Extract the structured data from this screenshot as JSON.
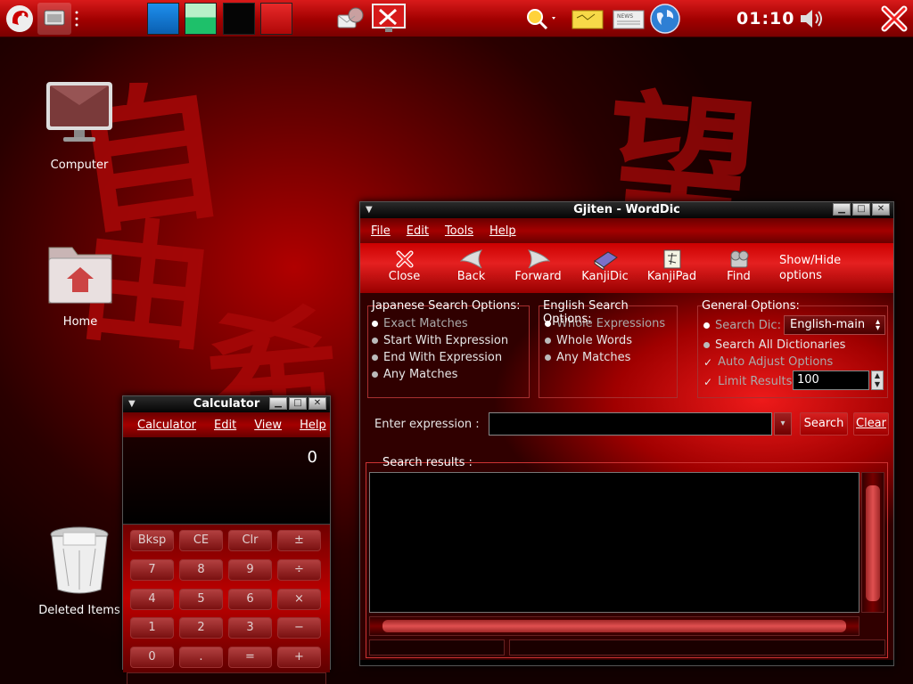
{
  "desktop": {
    "icons": [
      {
        "label": "Computer"
      },
      {
        "label": "Home"
      },
      {
        "label": "Deleted Items"
      }
    ],
    "background_glyphs": [
      "自",
      "由",
      "希",
      "望"
    ]
  },
  "panel": {
    "clock": "01:10",
    "swatch_colors": [
      "#0a6fd0",
      "#1ec06a",
      "#050505",
      "#d81818"
    ],
    "icons": [
      "gecko-menu-icon",
      "show-desktop-icon",
      "pager-icon",
      "mail-icon",
      "system-tools-icon",
      "search-icon",
      "notes-icon",
      "news-icon",
      "browser-globe-icon",
      "volume-icon",
      "close-icon"
    ]
  },
  "gjiten": {
    "title": "Gjiten - WordDic",
    "menu": [
      "File",
      "Edit",
      "Tools",
      "Help"
    ],
    "toolbar": [
      {
        "label": "Close",
        "icon": "close-icon"
      },
      {
        "label": "Back",
        "icon": "back-arrow-icon"
      },
      {
        "label": "Forward",
        "icon": "forward-arrow-icon"
      },
      {
        "label": "KanjiDic",
        "icon": "book-icon"
      },
      {
        "label": "KanjiPad",
        "icon": "pad-icon"
      },
      {
        "label": "Find",
        "icon": "find-icon"
      }
    ],
    "toggle_options": [
      "Show/Hide",
      "options"
    ],
    "japanese": {
      "title": "Japanese Search Options:",
      "options": [
        "Exact Matches",
        "Start With Expression",
        "End With Expression",
        "Any Matches"
      ]
    },
    "english": {
      "title": "English Search Options:",
      "options": [
        "Whole Expressions",
        "Whole Words",
        "Any Matches"
      ]
    },
    "general": {
      "title": "General Options:",
      "search_dic_label": "Search Dic:",
      "search_dic_value": "English-main",
      "search_all": "Search All Dictionaries",
      "auto_adjust": "Auto Adjust Options",
      "limit_label": "Limit Results:",
      "limit_value": "100"
    },
    "enter_label": "Enter expression :",
    "search_button": "Search",
    "clear_button": "Clear",
    "results_label": "Search results :"
  },
  "calculator": {
    "title": "Calculator",
    "menu": [
      "Calculator",
      "Edit",
      "View",
      "Help"
    ],
    "display": "0",
    "keys": [
      "Bksp",
      "CE",
      "Clr",
      "±",
      "7",
      "8",
      "9",
      "÷",
      "4",
      "5",
      "6",
      "×",
      "1",
      "2",
      "3",
      "−",
      "0",
      ".",
      "=",
      "+"
    ]
  }
}
